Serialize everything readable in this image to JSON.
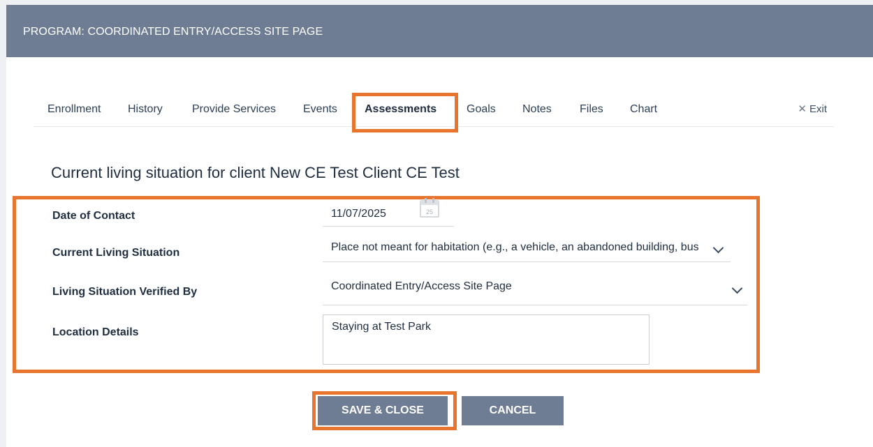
{
  "header": {
    "title": "PROGRAM: COORDINATED ENTRY/ACCESS SITE PAGE"
  },
  "tabs": [
    {
      "label": "Enrollment"
    },
    {
      "label": "History"
    },
    {
      "label": "Provide Services"
    },
    {
      "label": "Events"
    },
    {
      "label": "Assessments",
      "active": true
    },
    {
      "label": "Goals"
    },
    {
      "label": "Notes"
    },
    {
      "label": "Files"
    },
    {
      "label": "Chart"
    }
  ],
  "exit": {
    "label": "Exit",
    "icon": "close-icon"
  },
  "form": {
    "title": "Current living situation for client New CE Test Client CE Test",
    "date_of_contact": {
      "label": "Date of Contact",
      "value": "11/07/2025",
      "calendar_day": "25"
    },
    "current_living_situation": {
      "label": "Current Living Situation",
      "value": "Place not meant for habitation (e.g., a vehicle, an abandoned building, bus"
    },
    "verified_by": {
      "label": "Living Situation Verified By",
      "value": "Coordinated Entry/Access Site Page"
    },
    "location_details": {
      "label": "Location Details",
      "value": "Staying at Test Park"
    }
  },
  "buttons": {
    "save_close": "SAVE & CLOSE",
    "cancel": "CANCEL"
  },
  "colors": {
    "header_bg": "#6e7d94",
    "highlight": "#e8752d",
    "button_bg": "#6e7d94"
  }
}
